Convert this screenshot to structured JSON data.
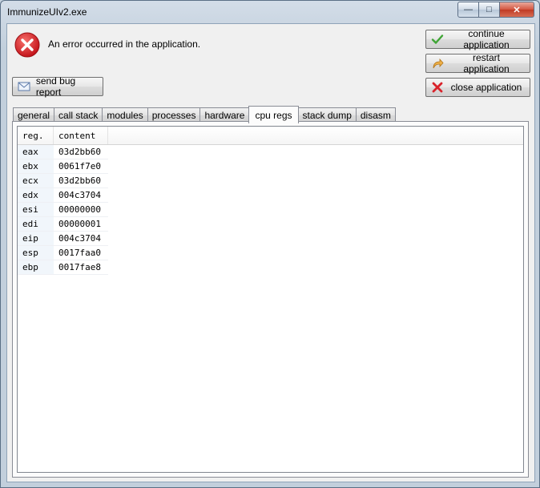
{
  "window": {
    "title": "ImmunizeUIv2.exe",
    "controls": {
      "minimize": "—",
      "maximize": "□",
      "close": "✕"
    }
  },
  "error": {
    "icon": "error-icon",
    "message": "An error occurred in the application."
  },
  "actions": {
    "continue_label": "continue application",
    "restart_label": "restart application",
    "close_label": "close application",
    "bug_report_label": "send bug report"
  },
  "tabs": [
    {
      "label": "general"
    },
    {
      "label": "call stack"
    },
    {
      "label": "modules"
    },
    {
      "label": "processes"
    },
    {
      "label": "hardware"
    },
    {
      "label": "cpu regs",
      "active": true
    },
    {
      "label": "stack dump"
    },
    {
      "label": "disasm"
    }
  ],
  "registers": {
    "columns": [
      "reg.",
      "content"
    ],
    "rows": [
      [
        "eax",
        "03d2bb60"
      ],
      [
        "ebx",
        "0061f7e0"
      ],
      [
        "ecx",
        "03d2bb60"
      ],
      [
        "edx",
        "004c3704"
      ],
      [
        "esi",
        "00000000"
      ],
      [
        "edi",
        "00000001"
      ],
      [
        "eip",
        "004c3704"
      ],
      [
        "esp",
        "0017faa0"
      ],
      [
        "ebp",
        "0017fae8"
      ]
    ]
  },
  "colors": {
    "error_red": "#d8232a",
    "continue_green": "#3fa535",
    "restart_orange": "#e8a02c",
    "close_red": "#d9232b"
  }
}
